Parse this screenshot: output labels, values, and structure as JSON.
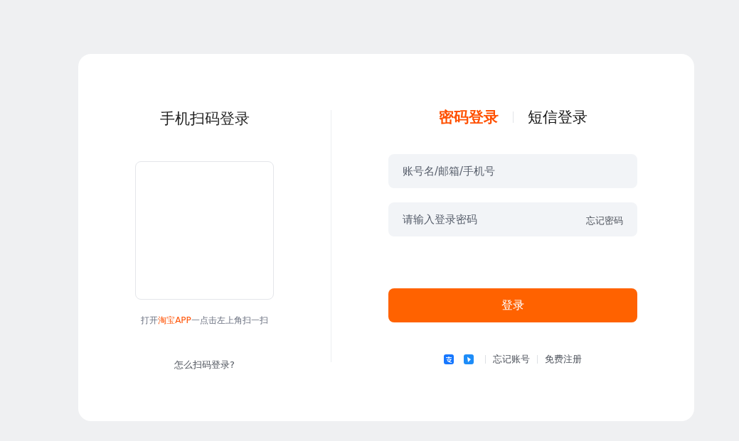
{
  "qr_login": {
    "title": "手机扫码登录",
    "hint": [
      {
        "text": "打开",
        "highlight": false
      },
      {
        "text": "淘宝APP",
        "highlight": true
      },
      {
        "text": "一点击左上角扫一扫",
        "highlight": false
      }
    ],
    "help_link": "怎么扫码登录?"
  },
  "tabs": [
    {
      "label": "密码登录",
      "selected": true
    },
    {
      "label": "短信登录",
      "selected": false
    }
  ],
  "account_field": {
    "placeholder": "账号名/邮箱/手机号"
  },
  "password_field": {
    "placeholder": "请输入登录密码",
    "forgot_link": "忘记密码"
  },
  "login_button": "登录",
  "footer_links": [
    "忘记账号",
    "免费注册"
  ]
}
